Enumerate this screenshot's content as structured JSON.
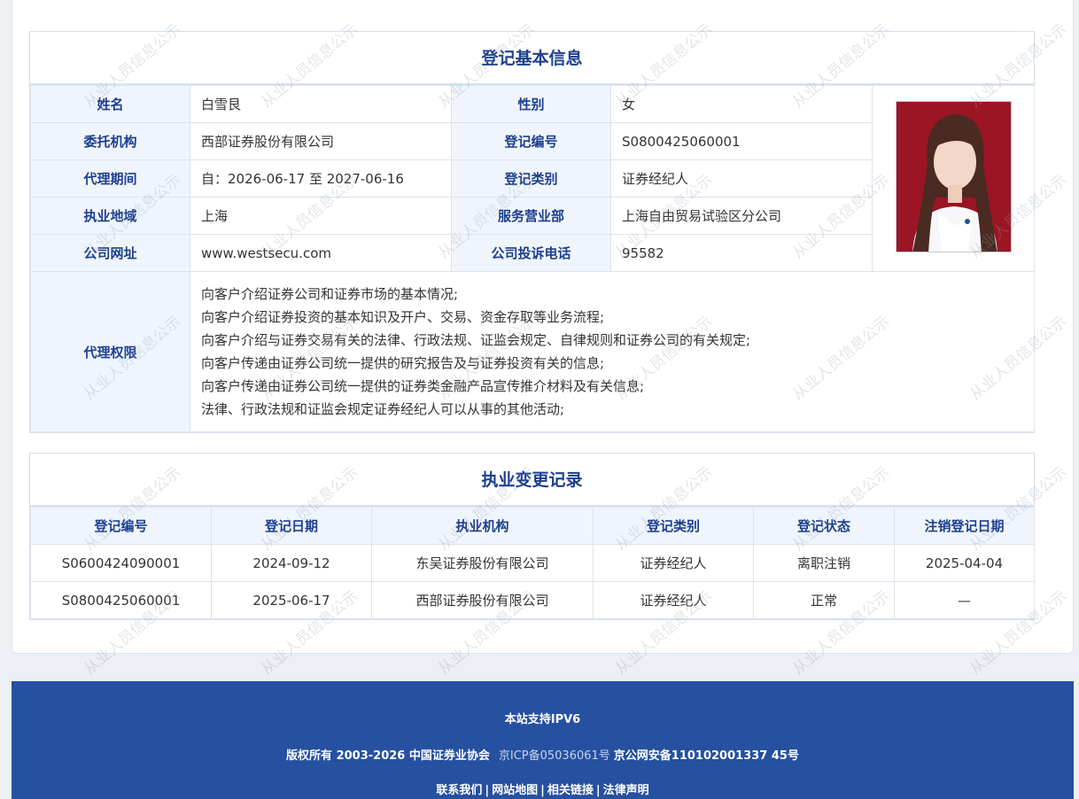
{
  "basic": {
    "title": "登记基本信息",
    "rows": [
      [
        {
          "label": "姓名",
          "value": "白雪艮"
        },
        {
          "label": "性别",
          "value": "女"
        }
      ],
      [
        {
          "label": "委托机构",
          "value": "西部证券股份有限公司"
        },
        {
          "label": "登记编号",
          "value": "S0800425060001"
        }
      ],
      [
        {
          "label": "代理期间",
          "value": "自：2026-06-17 至 2027-06-16"
        },
        {
          "label": "登记类别",
          "value": "证券经纪人"
        }
      ],
      [
        {
          "label": "执业地域",
          "value": "上海"
        },
        {
          "label": "服务营业部",
          "value": "上海自由贸易试验区分公司"
        }
      ],
      [
        {
          "label": "公司网址",
          "value": "www.westsecu.com"
        },
        {
          "label": "公司投诉电话",
          "value": "95582"
        }
      ]
    ],
    "authority_label": "代理权限",
    "authority_items": [
      "向客户介绍证券公司和证券市场的基本情况;",
      "向客户介绍证券投资的基本知识及开户、交易、资金存取等业务流程;",
      "向客户介绍与证券交易有关的法律、行政法规、证监会规定、自律规则和证券公司的有关规定;",
      "向客户传递由证券公司统一提供的研究报告及与证券投资有关的信息;",
      "向客户传递由证券公司统一提供的证券类金融产品宣传推介材料及有关信息;",
      "法律、行政法规和证监会规定证券经纪人可以从事的其他活动;"
    ]
  },
  "history": {
    "title": "执业变更记录",
    "columns": [
      "登记编号",
      "登记日期",
      "执业机构",
      "登记类别",
      "登记状态",
      "注销登记日期"
    ],
    "rows": [
      [
        "S0600424090001",
        "2024-09-12",
        "东吴证券股份有限公司",
        "证券经纪人",
        "离职注销",
        "2025-04-04"
      ],
      [
        "S0800425060001",
        "2025-06-17",
        "西部证券股份有限公司",
        "证券经纪人",
        "正常",
        "—"
      ]
    ]
  },
  "watermark_text": "从业人员信息公示",
  "footer": {
    "ipv6": "本站支持IPV6",
    "copyright": "版权所有 2003-2026 中国证券业协会",
    "icp": "京ICP备05036061号",
    "police": "京公网安备110102001337 45号",
    "links": [
      "联系我们",
      "网站地图",
      "相关链接",
      "法律声明"
    ]
  },
  "colors": {
    "header_text": "#1d3f8f",
    "label_bg": "#f0f5fd",
    "footer_bg": "#2650a0",
    "photo_bg": "#9b1524"
  }
}
